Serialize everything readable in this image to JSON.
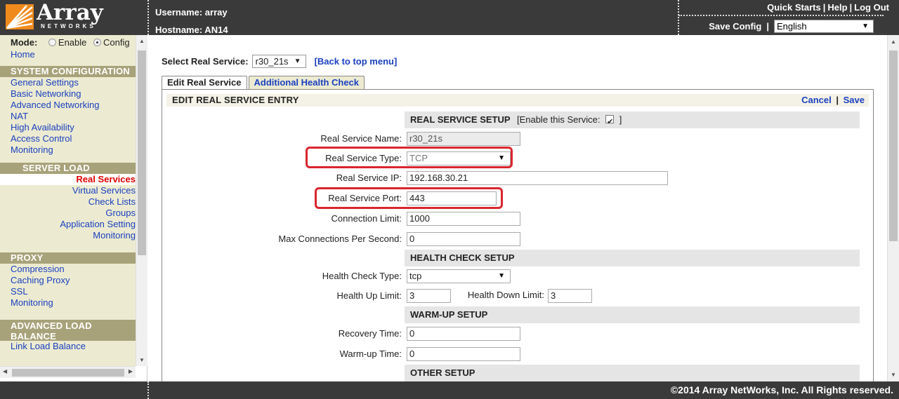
{
  "brand": {
    "name": "Array",
    "sub": "NETWORKS",
    "accent": "#f08a1c"
  },
  "header": {
    "username_label": "Username: array",
    "hostname_label": "Hostname: AN14",
    "quick_starts": "Quick Starts",
    "help": "Help",
    "logout": "Log Out",
    "sep": "|",
    "save_config": "Save Config",
    "language": "English"
  },
  "sidebar": {
    "mode_label": "Mode:",
    "mode_enable": "Enable",
    "mode_config": "Config",
    "home": "Home",
    "system_head": "SYSTEM CONFIGURATION",
    "system_items": [
      "General Settings",
      "Basic Networking",
      "Advanced Networking",
      "NAT",
      "High Availability",
      "Access Control",
      "Monitoring"
    ],
    "slb_head": "SERVER LOAD BALANCE",
    "slb_items": [
      "Real Services",
      "Virtual Services",
      "Check Lists",
      "Groups",
      "Application Setting",
      "Monitoring"
    ],
    "proxy_head": "PROXY",
    "proxy_items": [
      "Compression",
      "Caching Proxy",
      "SSL",
      "Monitoring"
    ],
    "alb_head_1": "ADVANCED LOAD",
    "alb_head_2": "BALANCE",
    "alb_items": [
      "Link Load Balance"
    ]
  },
  "main": {
    "select_label": "Select Real Service:",
    "selected_service": "r30_21s",
    "back_link": "[Back to top menu]",
    "tabs": [
      "Edit Real Service",
      "Additional Health Check"
    ],
    "panel_title": "EDIT REAL SERVICE ENTRY",
    "cancel": "Cancel",
    "save": "Save",
    "action_sep": "|",
    "sections": {
      "setup": "REAL SERVICE SETUP",
      "enable_service": "[Enable this Service:",
      "enable_close": "]",
      "health": "HEALTH CHECK SETUP",
      "warmup": "WARM-UP SETUP",
      "other": "OTHER SETUP"
    },
    "fields": {
      "name_label": "Real Service Name:",
      "name_value": "r30_21s",
      "type_label": "Real Service Type:",
      "type_value": "TCP",
      "ip_label": "Real Service IP:",
      "ip_value": "192.168.30.21",
      "port_label": "Real Service Port:",
      "port_value": "443",
      "conn_label": "Connection Limit:",
      "conn_value": "1000",
      "maxcps_label": "Max Connections Per Second:",
      "maxcps_value": "0",
      "hc_type_label": "Health Check Type:",
      "hc_type_value": "tcp",
      "hup_label": "Health Up Limit:",
      "hup_value": "3",
      "hdown_label": "Health Down Limit:",
      "hdown_value": "3",
      "recovery_label": "Recovery Time:",
      "recovery_value": "0",
      "warmup_label": "Warm-up Time:",
      "warmup_value": "0"
    },
    "highlight_color": "#d9262f"
  },
  "footer": {
    "copyright": "©2014 Array NetWorks, Inc. All Rights reserved."
  }
}
